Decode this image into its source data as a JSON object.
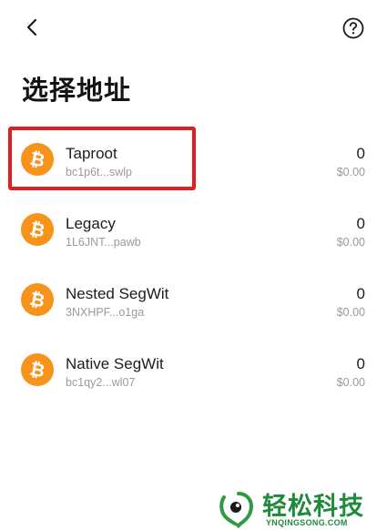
{
  "header": {
    "back_icon": "chevron-left-icon",
    "help_icon": "question-circle-icon"
  },
  "title": "选择地址",
  "addresses": [
    {
      "type": "Taproot",
      "address": "bc1p6t...swlp",
      "balance": "0",
      "fiat": "$0.00",
      "icon": "bitcoin-icon"
    },
    {
      "type": "Legacy",
      "address": "1L6JNT...pawb",
      "balance": "0",
      "fiat": "$0.00",
      "icon": "bitcoin-icon"
    },
    {
      "type": "Nested SegWit",
      "address": "3NXHPF...o1ga",
      "balance": "0",
      "fiat": "$0.00",
      "icon": "bitcoin-icon"
    },
    {
      "type": "Native SegWit",
      "address": "bc1qy2...wl07",
      "balance": "0",
      "fiat": "$0.00",
      "icon": "bitcoin-icon"
    }
  ],
  "colors": {
    "bitcoin_orange": "#f7931a",
    "highlight_red": "#e02020",
    "watermark_green": "#1f8a3a"
  },
  "watermark": {
    "text": "轻松科技",
    "sub": "YNQINGSONG.COM"
  }
}
